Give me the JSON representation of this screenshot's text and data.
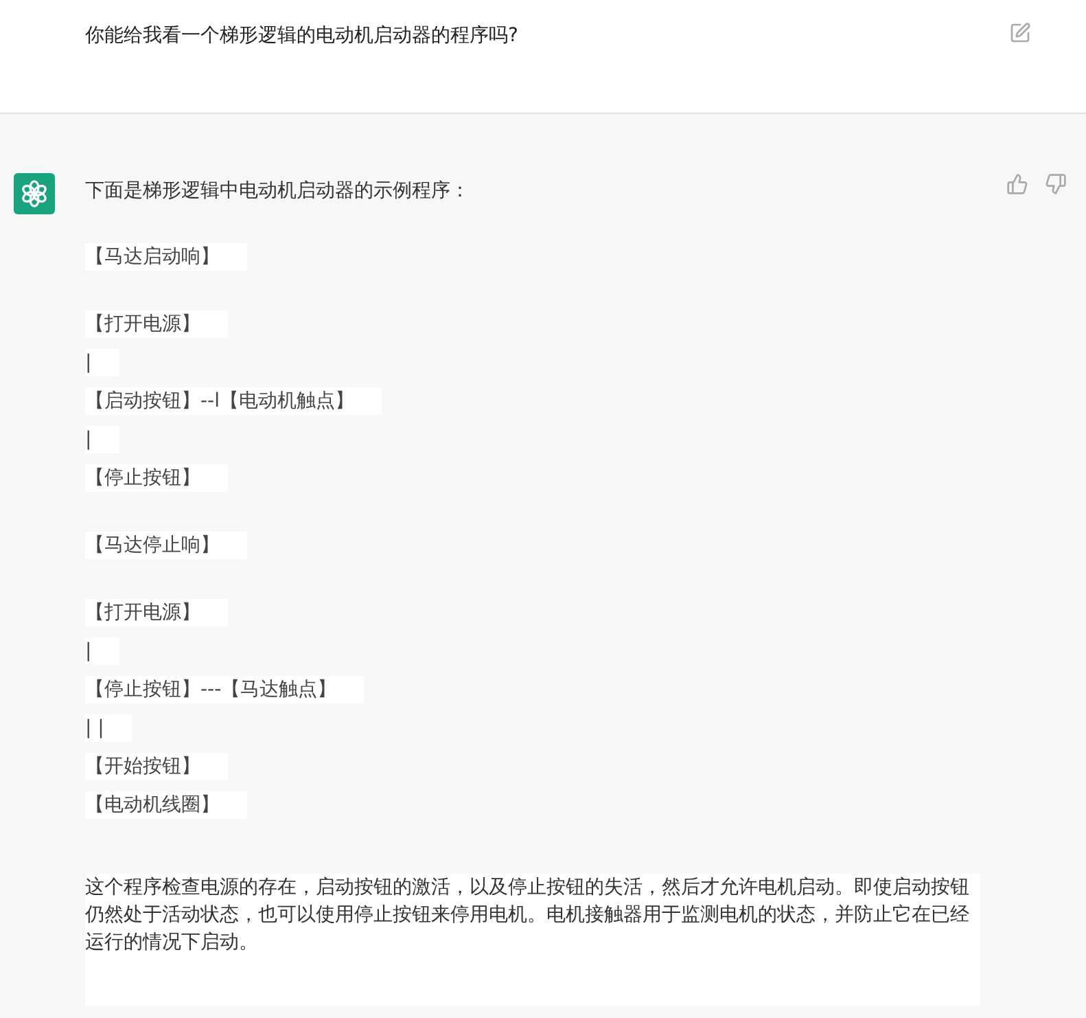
{
  "question": {
    "text": "你能给我看一个梯形逻辑的电动机启动器的程序吗?"
  },
  "answer": {
    "intro": "下面是梯形逻辑中电动机启动器的示例程序：",
    "blocks": [
      {
        "lines": [
          "【马达启动响】"
        ]
      },
      {
        "lines": [
          "【打开电源】",
          "|",
          "【启动按钮】--l【电动机触点】",
          "|",
          "【停止按钮】"
        ]
      },
      {
        "lines": [
          "【马达停止响】"
        ]
      },
      {
        "lines": [
          "【打开电源】",
          "|",
          "【停止按钮】---【马达触点】",
          "| |",
          "【开始按钮】",
          "【电动机线圈】"
        ]
      }
    ],
    "summary": "这个程序检查电源的存在，启动按钮的激活，以及停止按钮的失活，然后才允许电机启动。即使启动按钮仍然处于活动状态，也可以使用停止按钮来停用电机。电机接触器用于监测电机的状态，并防止它在已经运行的情况下启动。"
  }
}
